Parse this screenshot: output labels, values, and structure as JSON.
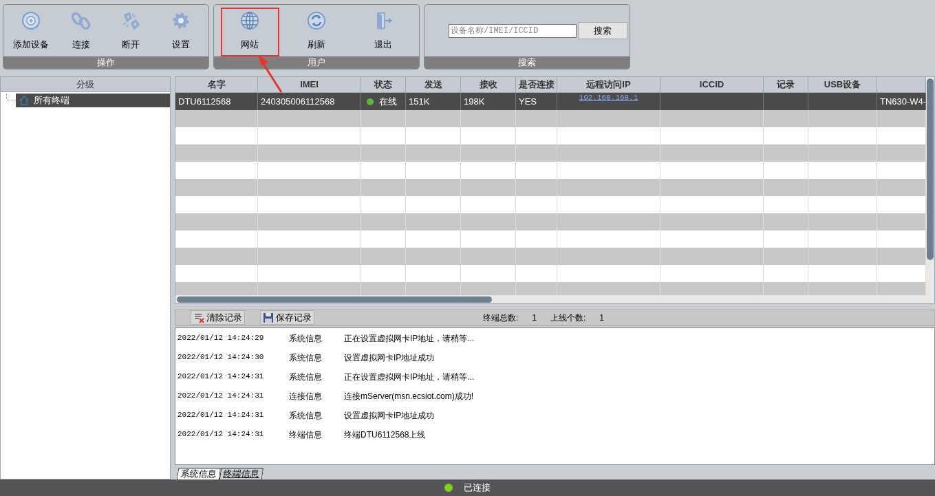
{
  "toolbar": {
    "groups": [
      {
        "title": "操作",
        "buttons": [
          {
            "label": "添加设备"
          },
          {
            "label": "连接"
          },
          {
            "label": "断开"
          },
          {
            "label": "设置"
          }
        ]
      },
      {
        "title": "用户",
        "buttons": [
          {
            "label": "网站",
            "highlighted": true
          },
          {
            "label": "刷新",
            "highlighted": false
          },
          {
            "label": "退出",
            "highlighted": false
          }
        ]
      },
      {
        "title": "搜索",
        "search": {
          "placeholder": "设备名称/IMEI/ICCID",
          "button": "搜索"
        }
      }
    ]
  },
  "sidebar": {
    "header": "分级",
    "items": [
      {
        "label": "所有终端",
        "selected": true
      }
    ]
  },
  "table": {
    "columns": [
      "名字",
      "IMEI",
      "状态",
      "发送",
      "接收",
      "是否连接",
      "远程访问IP",
      "ICCID",
      "记录",
      "USB设备",
      ""
    ],
    "rows": [
      {
        "selected": true,
        "online": true,
        "cells": [
          "DTU6112568",
          "240305006112568",
          "在线",
          "151K",
          "198K",
          "YES",
          "192.168.168.1",
          "",
          "",
          "",
          "TN630-W4-"
        ]
      }
    ]
  },
  "log": {
    "buttons": [
      {
        "label": "清除记录"
      },
      {
        "label": "保存记录"
      }
    ],
    "total_label": "终端总数:",
    "total": "1",
    "online_label": "上线个数:",
    "online": "1",
    "entries": [
      {
        "time": "2022/01/12 14:24:29",
        "type": "系统信息",
        "message": "正在设置虚拟网卡IP地址，请稍等..."
      },
      {
        "time": "2022/01/12 14:24:30",
        "type": "系统信息",
        "message": "设置虚拟网卡IP地址成功"
      },
      {
        "time": "2022/01/12 14:24:31",
        "type": "系统信息",
        "message": "正在设置虚拟网卡IP地址，请稍等..."
      },
      {
        "time": "2022/01/12 14:24:31",
        "type": "连接信息",
        "message": "连接mServer(msn.ecsiot.com)成功!"
      },
      {
        "time": "2022/01/12 14:24:31",
        "type": "系统信息",
        "message": "设置虚拟网卡IP地址成功"
      },
      {
        "time": "2022/01/12 14:24:31",
        "type": "终端信息",
        "message": "终端DTU6112568上线"
      }
    ],
    "tabs": [
      {
        "label": "系统信息",
        "selected": true
      },
      {
        "label": "终端信息",
        "selected": false
      }
    ]
  },
  "status_bar": {
    "connected": true,
    "text": "已连接"
  }
}
